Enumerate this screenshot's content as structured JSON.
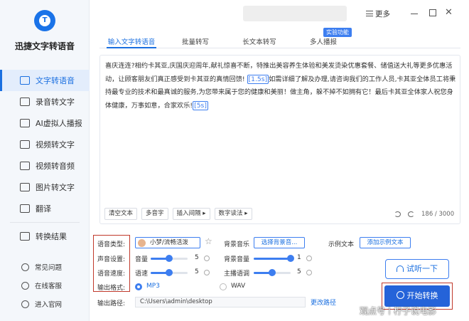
{
  "app": {
    "name": "迅捷文字转语音",
    "logo_letter": "T"
  },
  "titlebar": {
    "more_label": "更多"
  },
  "sidebar": {
    "items": [
      {
        "label": "文字转语音",
        "icon": "text-to-speech-icon",
        "active": true
      },
      {
        "label": "录音转文字",
        "icon": "recording-icon"
      },
      {
        "label": "AI虚拟人播报",
        "icon": "ai-avatar-icon"
      },
      {
        "label": "视频转文字",
        "icon": "video-icon"
      },
      {
        "label": "视频转音频",
        "icon": "video-audio-icon"
      },
      {
        "label": "图片转文字",
        "icon": "image-icon"
      },
      {
        "label": "翻译",
        "icon": "translate-icon"
      },
      {
        "label": "转换结果",
        "icon": "result-icon"
      }
    ],
    "bottom": [
      {
        "label": "常见问题",
        "icon": "help-icon"
      },
      {
        "label": "在线客服",
        "icon": "support-icon"
      },
      {
        "label": "进入官网",
        "icon": "website-icon"
      }
    ]
  },
  "tabs": [
    {
      "label": "输入文字转语音",
      "active": true
    },
    {
      "label": "批量转写"
    },
    {
      "label": "长文本转写"
    },
    {
      "label": "多人播报"
    }
  ],
  "beta_badge": "实验功能",
  "editor": {
    "text_before": "喜庆连连?相约卡其亚,庆国庆迎周年,献礼惊喜不断，特推出美容养生体验和美发烫染优惠套餐、储值送大礼等更多优惠活动，让顾客朋友们真正感受到卡其亚的真情回馈! ",
    "pause1": "[1.5s]",
    "text_middle": "如需详细了解及办理,请咨询我们的工作人员,卡其亚全体员工将秉持最专业的技术和最真诚的服务,为您带来属于您的健康和美丽！做主角，躲不掉不如拥有它！最后卡其亚全体家人祝您身体健康，万事如意，合家欢乐!",
    "pause2": "[5s]",
    "toolbar": {
      "clear": "清空文本",
      "polyphone": "多音字",
      "insert_pause": "插入间隔 ▸",
      "number_reading": "数字读法 ▸"
    },
    "char_count": "186 / 3000"
  },
  "settings": {
    "voice_type_label": "语音类型:",
    "voice_name": "小梦/流畅活泼",
    "bg_music_label": "背景音乐",
    "bg_music_button": "选择背景音...",
    "sample_text_label": "示例文本",
    "sample_text_button": "添加示例文本",
    "sound_label": "声音设置:",
    "volume_label": "音量",
    "volume_value": 5,
    "bg_volume_label": "背景音量",
    "bg_volume_value": 1,
    "speed_label": "语音速度:",
    "speed_name": "语速",
    "speed_value": 5,
    "tone_label": "主播语调",
    "tone_value": 5,
    "format_label": "输出格式:",
    "format_mp3": "MP3",
    "format_wav": "WAV",
    "selected_format": "MP3",
    "output_path_label": "输出路径:",
    "output_path": "C:\\Users\\admin\\desktop",
    "change_path": "更改路径"
  },
  "actions": {
    "listen": "试听一下",
    "start": "开始转换"
  },
  "watermark": "观点号丨柠子说电影",
  "colors": {
    "accent": "#1a6fe0",
    "highlight_box": "#c0392b",
    "primary_button": "#2563d9"
  }
}
